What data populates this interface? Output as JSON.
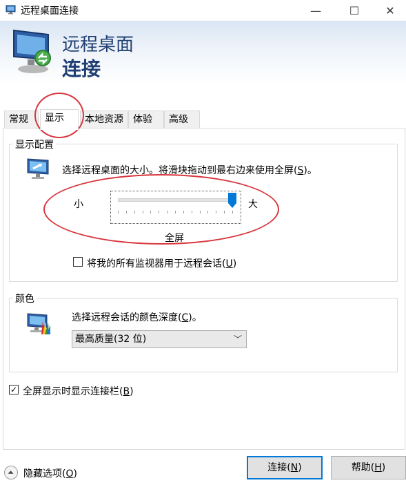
{
  "window": {
    "title": "远程桌面连接",
    "minimize_glyph": "—",
    "maximize_glyph": "☐",
    "close_glyph": "✕"
  },
  "banner": {
    "line1": "远程桌面",
    "line2": "连接"
  },
  "tabs": [
    {
      "label": "常规"
    },
    {
      "label": "显示"
    },
    {
      "label": "本地资源"
    },
    {
      "label": "体验"
    },
    {
      "label": "高级"
    }
  ],
  "active_tab": "显示",
  "display_config": {
    "group_label": "显示配置",
    "instruction": "选择远程桌面的大小。将滑块拖动到最右边来使用全屏(",
    "instruction_key": "S",
    "instruction_end": ")。",
    "small_label": "小",
    "large_label": "大",
    "slider_value_label": "全屏",
    "slider_position": 1.0,
    "multi_monitor_label": "将我的所有监视器用于远程会话(",
    "multi_monitor_key": "U",
    "multi_monitor_end": ")",
    "multi_monitor_checked": false
  },
  "color": {
    "group_label": "颜色",
    "instruction": "选择远程会话的颜色深度(",
    "instruction_key": "C",
    "instruction_end": ")。",
    "selected_depth": "最高质量(32 位)"
  },
  "connection_bar": {
    "label": "全屏显示时显示连接栏(",
    "key": "B",
    "end": ")",
    "checked": true,
    "check_glyph": "✓"
  },
  "footer": {
    "hide_options": "隐藏选项(",
    "hide_options_key": "O",
    "hide_options_end": ")",
    "connect_label": "连接(",
    "connect_key": "N",
    "connect_end": ")",
    "help_label": "帮助(",
    "help_key": "H",
    "help_end": ")"
  },
  "colors": {
    "accent": "#0078d7",
    "banner_text": "#1f3f73",
    "annotation": "#d9363e"
  }
}
